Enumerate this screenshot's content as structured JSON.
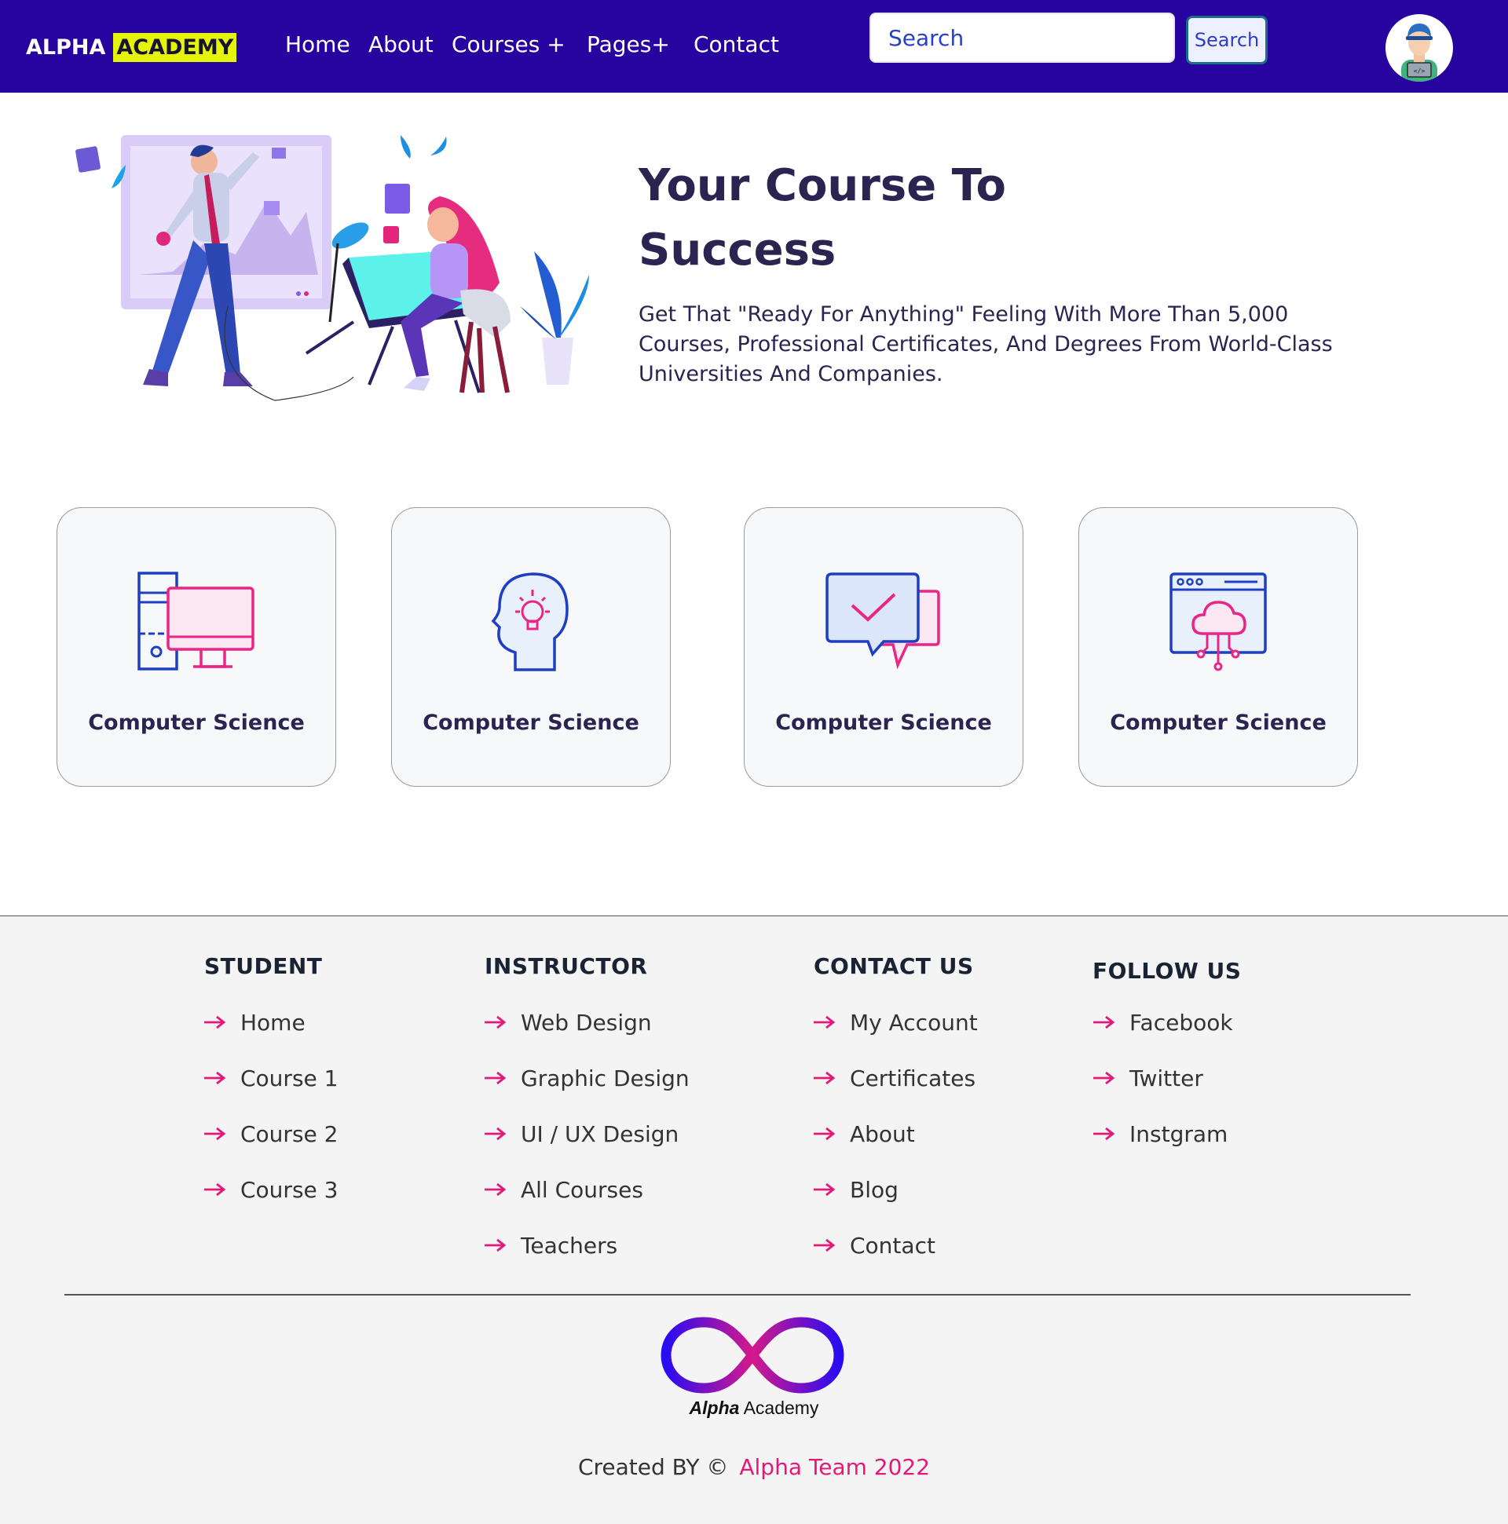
{
  "navbar": {
    "brand": {
      "part1": "ALPHA",
      "part2": "ACADEMY"
    },
    "links": [
      {
        "label": "Home"
      },
      {
        "label": "About"
      },
      {
        "label": "Courses +"
      },
      {
        "label": "Pages+"
      },
      {
        "label": "Contact"
      }
    ],
    "search": {
      "placeholder": "Search",
      "button_label": "Search"
    },
    "avatar_icon": "developer-avatar-icon"
  },
  "hero": {
    "title": "Your Course To Success",
    "description": "Get That \"Ready For Anything\" Feeling With More Than 5,000 Courses, Professional Certificates, And Degrees From World-Class Universities And Companies."
  },
  "categories": [
    {
      "label": "Computer Science",
      "icon": "computer-icon"
    },
    {
      "label": "Computer Science",
      "icon": "idea-head-icon"
    },
    {
      "label": "Computer Science",
      "icon": "chat-check-icon"
    },
    {
      "label": "Computer Science",
      "icon": "cloud-network-icon"
    }
  ],
  "footer": {
    "columns": [
      {
        "title": "STUDENT",
        "links": [
          "Home",
          "Course 1",
          "Course 2",
          "Course 3"
        ]
      },
      {
        "title": "INSTRUCTOR",
        "links": [
          "Web Design",
          "Graphic Design",
          "UI / UX Design",
          "All Courses",
          "Teachers"
        ]
      },
      {
        "title": "CONTACT US",
        "links": [
          "My Account",
          "Certificates",
          "About",
          "Blog",
          "Contact"
        ]
      },
      {
        "title": "FOLLOW US",
        "links": [
          "Facebook",
          "Twitter",
          "Instgram"
        ]
      }
    ],
    "brand": {
      "part1": "Alpha",
      "part2": "Academy"
    },
    "credit": {
      "prefix": "Created BY ©",
      "team": "Alpha Team 2022"
    }
  },
  "colors": {
    "nav_bg": "#2704a0",
    "accent": "#e3197a",
    "highlight": "#e4f50b",
    "footer_bg": "#f4f4f4"
  }
}
